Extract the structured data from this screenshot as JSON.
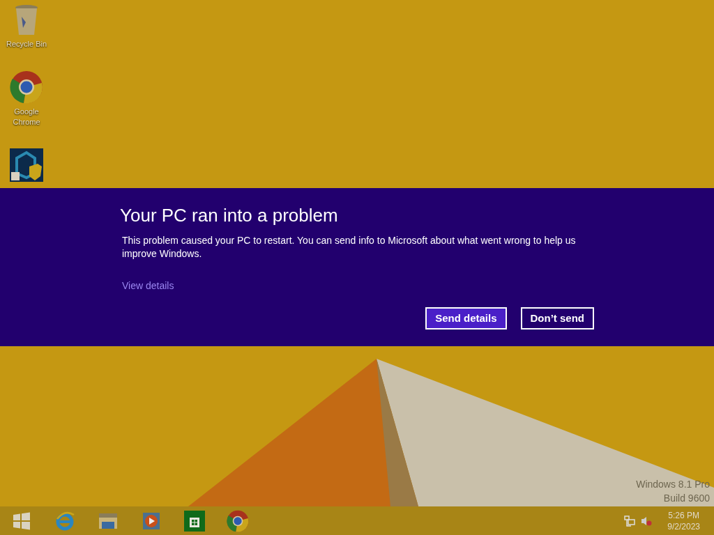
{
  "desktop_icons": [
    {
      "kind": "recycle",
      "label": "Recycle Bin"
    },
    {
      "kind": "chrome",
      "label": "Google Chrome"
    },
    {
      "kind": "shield"
    }
  ],
  "dialog": {
    "title": "Your PC ran into a problem",
    "message": "This problem caused your PC to restart. You can send info to Microsoft about what went wrong to help us improve Windows.",
    "link": "View details",
    "buttons": [
      {
        "label": "Send details",
        "selected": true
      },
      {
        "label": "Don’t send",
        "selected": false
      }
    ]
  },
  "watermark": [
    "Windows 8.1 Pro",
    "Build 9600"
  ],
  "taskbar": {
    "apps": [
      {
        "kind": "start"
      },
      {
        "kind": "ie"
      },
      {
        "kind": "explorer"
      },
      {
        "kind": "media"
      },
      {
        "kind": "store"
      },
      {
        "kind": "chrome"
      }
    ],
    "tray": {
      "time": "5:26 PM",
      "date": "9/2/2023",
      "muted": true
    }
  }
}
